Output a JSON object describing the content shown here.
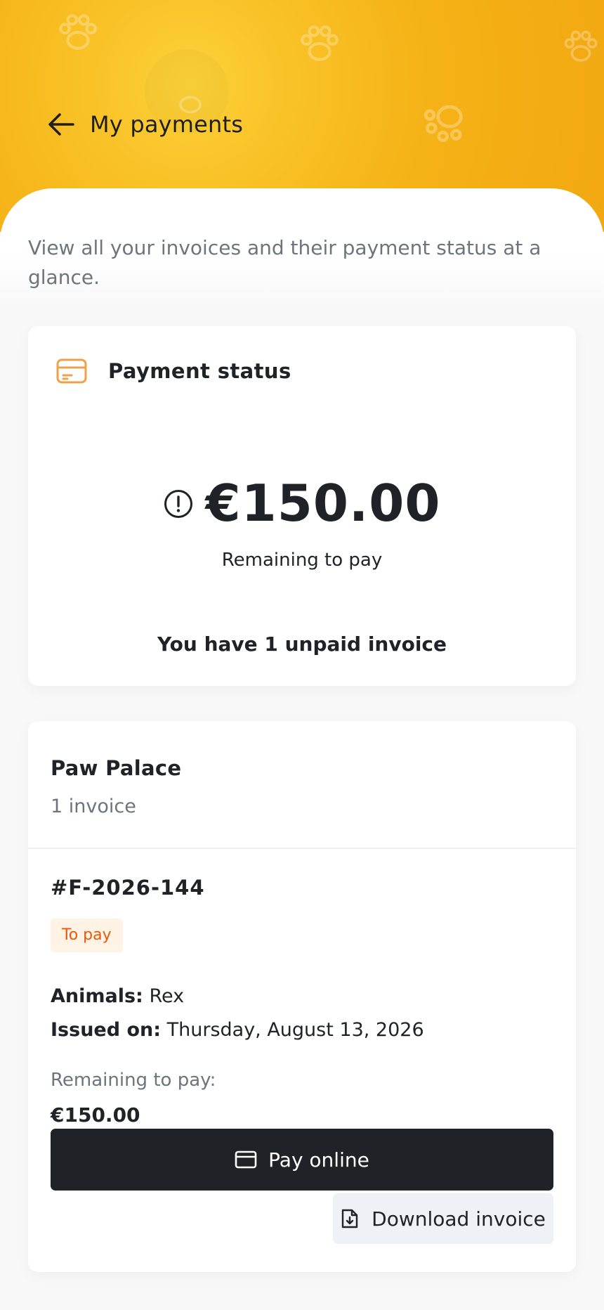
{
  "header": {
    "title": "My payments",
    "back_icon": "arrow-left-icon"
  },
  "intro": "View all your invoices and their payment status at a glance.",
  "payment_status": {
    "title": "Payment status",
    "icon": "credit-card-icon",
    "amount": "€150.00",
    "amount_label": "Remaining to pay",
    "summary": "You have 1 unpaid invoice",
    "alert_icon": "alert-circle-icon"
  },
  "clinic": {
    "name": "Paw Palace",
    "invoice_count": "1 invoice",
    "invoice": {
      "number": "#F-2026-144",
      "status": "To pay",
      "animals_label": "Animals:",
      "animals_value": "Rex",
      "issued_label": "Issued on:",
      "issued_value": "Thursday, August 13, 2026",
      "remaining_label": "Remaining to pay:",
      "remaining_value": "€150.00",
      "pay_button": "Pay online",
      "download_button": "Download invoice"
    }
  },
  "colors": {
    "header_yellow": "#f5b216",
    "accent_orange": "#f0a04b",
    "badge_text": "#e8590c",
    "badge_bg": "#fff3e6",
    "dark_button": "#1f2327"
  }
}
